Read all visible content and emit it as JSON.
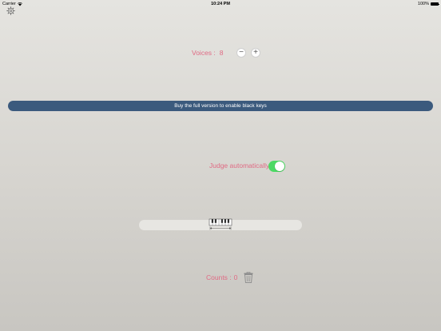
{
  "status_bar": {
    "carrier": "Carrier",
    "time": "10:24 PM",
    "battery": "100%",
    "battery_level": 1.0,
    "wifi_icon": "wifi-icon",
    "battery_icon": "battery-icon"
  },
  "settings": {
    "icon": "gear-icon"
  },
  "voices": {
    "label": "Voices :",
    "value": "8",
    "minus_label": "−",
    "plus_label": "+"
  },
  "banner": {
    "text": "Buy the full version to enable black keys"
  },
  "judge": {
    "label": "Judge automatically",
    "enabled": true
  },
  "range": {
    "icon": "piano-keys-icon"
  },
  "counts": {
    "label": "Counts :",
    "value": "0",
    "icon": "trash-icon"
  },
  "colors": {
    "accent_text": "#e06b84",
    "banner_bg": "#3b5a7d",
    "toggle_on": "#4cd964"
  }
}
